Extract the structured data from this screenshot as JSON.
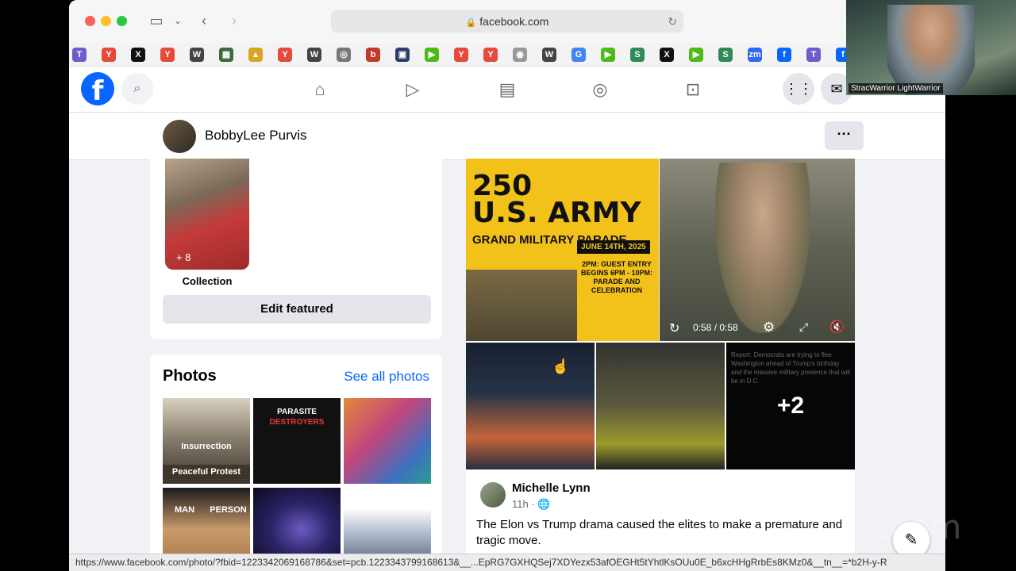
{
  "browser": {
    "url": "facebook.com",
    "status_url": "https://www.facebook.com/photo/?fbid=1223342069168786&set=pcb.1223343799168613&__...EpRG7GXHQSej7XDYezx53afOEGHt5tYhtlKsOUu0E_b6xcHHgRrbEs8KMz0&__tn__=*b2H-y-R"
  },
  "bookmarks": [
    {
      "icon": "T",
      "color": "#6e5cc9"
    },
    {
      "icon": "Y",
      "color": "#e64a3b"
    },
    {
      "icon": "X",
      "color": "#111111"
    },
    {
      "icon": "Y",
      "color": "#e64a3b"
    },
    {
      "icon": "W",
      "color": "#444444"
    },
    {
      "icon": "▦",
      "color": "#3b6b3b"
    },
    {
      "icon": "▲",
      "color": "#d9a520"
    },
    {
      "icon": "Y",
      "color": "#e64a3b"
    },
    {
      "icon": "W",
      "color": "#444444"
    },
    {
      "icon": "◎",
      "color": "#777777"
    },
    {
      "icon": "b",
      "color": "#c0392b"
    },
    {
      "icon": "▣",
      "color": "#2c3e70"
    },
    {
      "icon": "▶",
      "color": "#4cbb17"
    },
    {
      "icon": "Y",
      "color": "#e64a3b"
    },
    {
      "icon": "Y",
      "color": "#e64a3b"
    },
    {
      "icon": "◉",
      "color": "#999999"
    },
    {
      "icon": "W",
      "color": "#444444"
    },
    {
      "icon": "G",
      "color": "#4285f4"
    },
    {
      "icon": "▶",
      "color": "#4cbb17"
    },
    {
      "icon": "S",
      "color": "#2e8b57"
    },
    {
      "icon": "X",
      "color": "#111111"
    },
    {
      "icon": "▶",
      "color": "#4cbb17"
    },
    {
      "icon": "S",
      "color": "#2e8b57"
    },
    {
      "icon": "zm",
      "color": "#2d6bf2"
    },
    {
      "icon": "f",
      "color": "#0866ff"
    },
    {
      "icon": "T",
      "color": "#6e5cc9"
    },
    {
      "icon": "f",
      "color": "#0866ff"
    }
  ],
  "profile": {
    "name": "BobbyLee Purvis",
    "more": "···"
  },
  "featured": {
    "thumb_count": "+ 8",
    "caption": "Collection",
    "edit_label": "Edit featured"
  },
  "photos": {
    "title": "Photos",
    "see_all": "See all photos",
    "captions": [
      "Insurrection",
      "Peaceful Protest",
      "PARASITE",
      "DESTROYERS",
      "MAN",
      "PERSON"
    ]
  },
  "post": {
    "army": {
      "big": "250",
      "big2": "U.S. ARMY",
      "sub": "GRAND MILITARY PARADE",
      "date": "JUNE 14TH, 2025",
      "info": "2PM: GUEST ENTRY BEGINS 6PM - 10PM: PARADE AND CELEBRATION"
    },
    "video_time": "0:58 / 0:58",
    "more_count": "+2",
    "report_text": "Report: Democrats are trying to flee Washington ahead of Trump's birthday and the massive military presence that will be in D.C.",
    "author": "Michelle Lynn",
    "time": "11h · 🌐",
    "text": "The Elon vs Trump drama caused the elites to make a premature and tragic move."
  },
  "zoom": {
    "participant": "StracWarrior LightWarrior",
    "watermark": "zoom"
  },
  "colors": {
    "fb_blue": "#0866ff",
    "army_yellow": "#f2c21b"
  }
}
